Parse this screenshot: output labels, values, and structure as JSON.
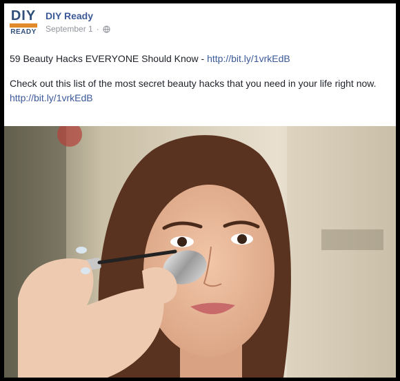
{
  "page": {
    "logo": {
      "top_text": "DIY",
      "bottom_text": "READY",
      "colors": {
        "navy": "#2f4f7a",
        "orange": "#e08a2c"
      }
    },
    "name": "DIY Ready",
    "date": "September 1",
    "privacy_icon": "globe-icon"
  },
  "post": {
    "line1_text": "59 Beauty Hacks EVERYONE Should Know - ",
    "line1_link": "http://bit.ly/1vrkEdB",
    "body_text": "Check out this list of the most secret beauty hacks that you need in your life right now. ",
    "body_link": "http://bit.ly/1vrkEdB",
    "link_color": "#3b5998"
  },
  "photo": {
    "description_icon": "photo-woman-mascara-spoon"
  }
}
